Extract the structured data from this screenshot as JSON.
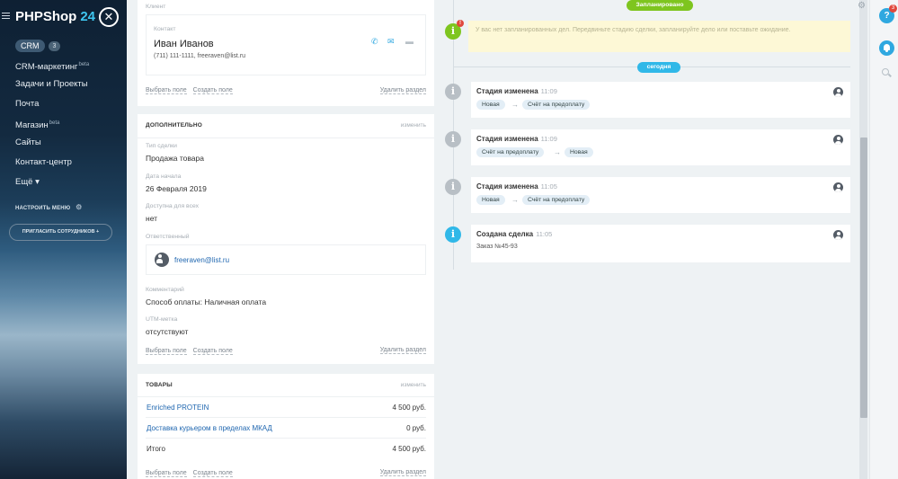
{
  "sidebar": {
    "brand": "PHPShop",
    "brand_num": "24",
    "menu": [
      {
        "label": "CRM",
        "count": "3"
      },
      {
        "label": "CRM-маркетинг",
        "sup": "beta"
      },
      {
        "label": "Задачи и Проекты"
      },
      {
        "label": "Почта"
      },
      {
        "label": "Магазин",
        "sup": "beta"
      },
      {
        "label": "Сайты"
      },
      {
        "label": "Контакт-центр"
      },
      {
        "label": "Ещё ▾"
      }
    ],
    "setup_menu": "НАСТРОИТЬ МЕНЮ",
    "invite": "ПРИГЛАСИТЬ СОТРУДНИКОВ +"
  },
  "client": {
    "section_label": "Клиент",
    "contact_label": "Контакт",
    "contact_name": "Иван Иванов",
    "contact_details": "(711) 111-1111, freeraven@list.ru",
    "select_field": "Выбрать поле",
    "create_field": "Создать поле",
    "delete_section": "Удалить раздел"
  },
  "additional": {
    "title": "ДОПОЛНИТЕЛЬНО",
    "change": "изменить",
    "fields": [
      {
        "label": "Тип сделки",
        "value": "Продажа товара"
      },
      {
        "label": "Дата начала",
        "value": "26 Февраля 2019"
      },
      {
        "label": "Доступна для всех",
        "value": "нет"
      }
    ],
    "responsible_label": "Ответственный",
    "responsible_value": "freeraven@list.ru",
    "comment_label": "Комментарий",
    "comment_value": "Способ оплаты: Наличная оплата",
    "utm_label": "UTM-метка",
    "utm_value": "отсутствуют",
    "select_field": "Выбрать поле",
    "create_field": "Создать поле",
    "delete_section": "Удалить раздел"
  },
  "products": {
    "title": "ТОВАРЫ",
    "change": "изменить",
    "rows": [
      {
        "name": "Enriched PROTEIN",
        "price": "4 500 руб."
      },
      {
        "name": "Доставка курьером в пределах МКАД",
        "price": "0 руб."
      }
    ],
    "total_label": "Итого",
    "total_value": "4 500 руб.",
    "select_field": "Выбрать поле",
    "create_field": "Создать поле",
    "delete_section": "Удалить раздел"
  },
  "timeline": {
    "planned_label": "Запланировано",
    "planned_badge": "!",
    "planned_text": "У вас нет запланированных дел. Передвиньте стадию сделки, запланируйте дело или поставьте ожидание.",
    "today_label": "сегодня",
    "events": [
      {
        "title": "Стадия изменена",
        "time": "11:09",
        "from": "Новая",
        "to": "Счёт на предоплату"
      },
      {
        "title": "Стадия изменена",
        "time": "11:09",
        "from": "Счёт на предоплату",
        "to": "Новая"
      },
      {
        "title": "Стадия изменена",
        "time": "11:05",
        "from": "Новая",
        "to": "Счёт на предоплату"
      }
    ],
    "created": {
      "title": "Создана сделка",
      "time": "11:05",
      "text": "Заказ №45-93"
    }
  },
  "rightbar": {
    "help": "?",
    "help_badge": "3"
  },
  "colors": {
    "accent": "#2fa8e0",
    "planned": "#7ec51f",
    "today": "#30b8e8",
    "link": "#2067b0"
  }
}
